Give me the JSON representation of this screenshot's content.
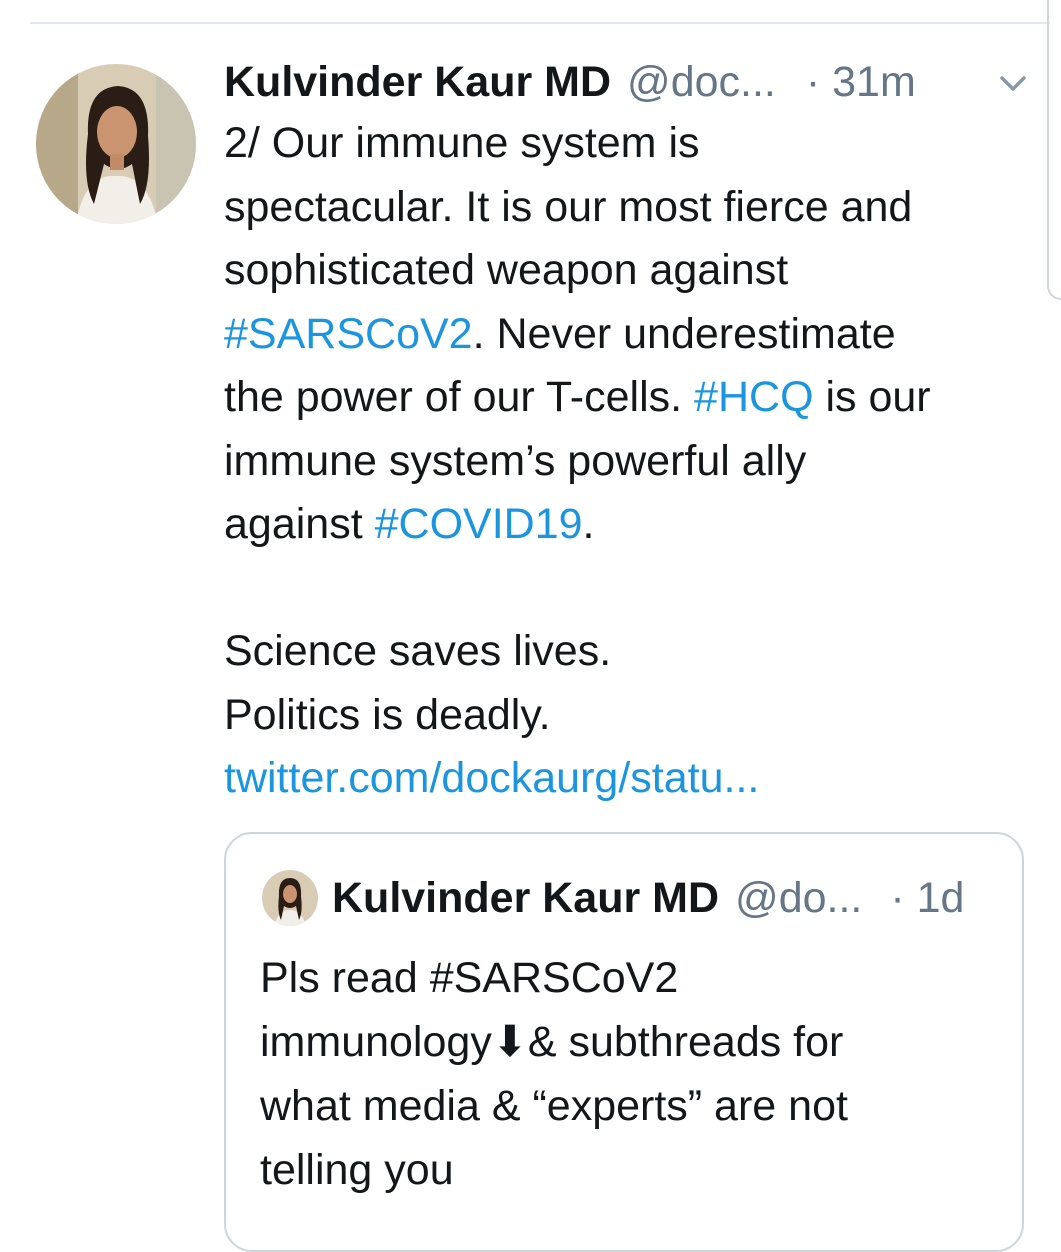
{
  "tweet": {
    "author_name": "Kulvinder Kaur MD",
    "author_handle": "@doc...",
    "time": "· 31m",
    "caret_icon": "chevron-down-icon",
    "text": {
      "line1": "2/ Our immune system is",
      "line2": "spectacular. It is our most fierce and",
      "line3": "sophisticated weapon against",
      "line4_tag": "#SARSCoV2",
      "line4_rest": ". Never underestimate",
      "line5_start": "the power of our T-cells. ",
      "line5_tag": "#HCQ",
      "line5_rest": " is our",
      "line6": "immune system’s powerful ally",
      "line7_start": "against ",
      "line7_tag": "#COVID19",
      "line7_rest": ".",
      "line8": "Science saves lives.",
      "line9": "Politics is deadly.",
      "link": "twitter.com/dockaurg/statu..."
    }
  },
  "quoted_tweet": {
    "author_name": "Kulvinder Kaur MD",
    "author_handle": "@do...",
    "time": "· 1d",
    "text": {
      "line1": "Pls read #SARSCoV2",
      "line2": "immunology⬇& subthreads for",
      "line3": "what media & “experts” are not",
      "line4": "telling you"
    }
  },
  "colors": {
    "text": "#14171a",
    "secondary": "#657786",
    "link": "#1b95e0",
    "border": "#ccd6dd"
  }
}
